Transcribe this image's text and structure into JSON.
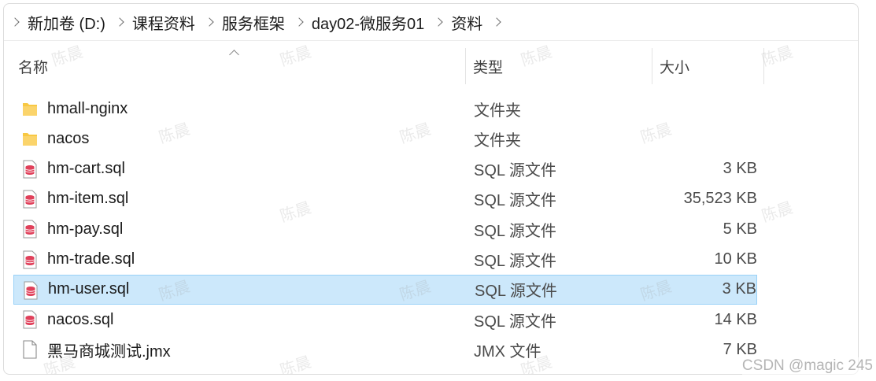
{
  "breadcrumb": [
    "新加卷 (D:)",
    "课程资料",
    "服务框架",
    "day02-微服务01",
    "资料"
  ],
  "columns": {
    "name": "名称",
    "type": "类型",
    "size": "大小"
  },
  "files": [
    {
      "name": "hmall-nginx",
      "type": "文件夹",
      "size": "",
      "icon": "folder-icon"
    },
    {
      "name": "nacos",
      "type": "文件夹",
      "size": "",
      "icon": "folder-icon"
    },
    {
      "name": "hm-cart.sql",
      "type": "SQL 源文件",
      "size": "3 KB",
      "icon": "sql-file-icon"
    },
    {
      "name": "hm-item.sql",
      "type": "SQL 源文件",
      "size": "35,523 KB",
      "icon": "sql-file-icon"
    },
    {
      "name": "hm-pay.sql",
      "type": "SQL 源文件",
      "size": "5 KB",
      "icon": "sql-file-icon"
    },
    {
      "name": "hm-trade.sql",
      "type": "SQL 源文件",
      "size": "10 KB",
      "icon": "sql-file-icon"
    },
    {
      "name": "hm-user.sql",
      "type": "SQL 源文件",
      "size": "3 KB",
      "icon": "sql-file-icon",
      "selected": true
    },
    {
      "name": "nacos.sql",
      "type": "SQL 源文件",
      "size": "14 KB",
      "icon": "sql-file-icon"
    },
    {
      "name": "黑马商城测试.jmx",
      "type": "JMX 文件",
      "size": "7 KB",
      "icon": "file-icon"
    }
  ],
  "watermark": "陈晨",
  "credit": "CSDN @magic 245",
  "colors": {
    "selection": "#cce8fb",
    "selection_border": "#99d1f7",
    "folder": "#f8c843",
    "sql": "#e0405a"
  }
}
